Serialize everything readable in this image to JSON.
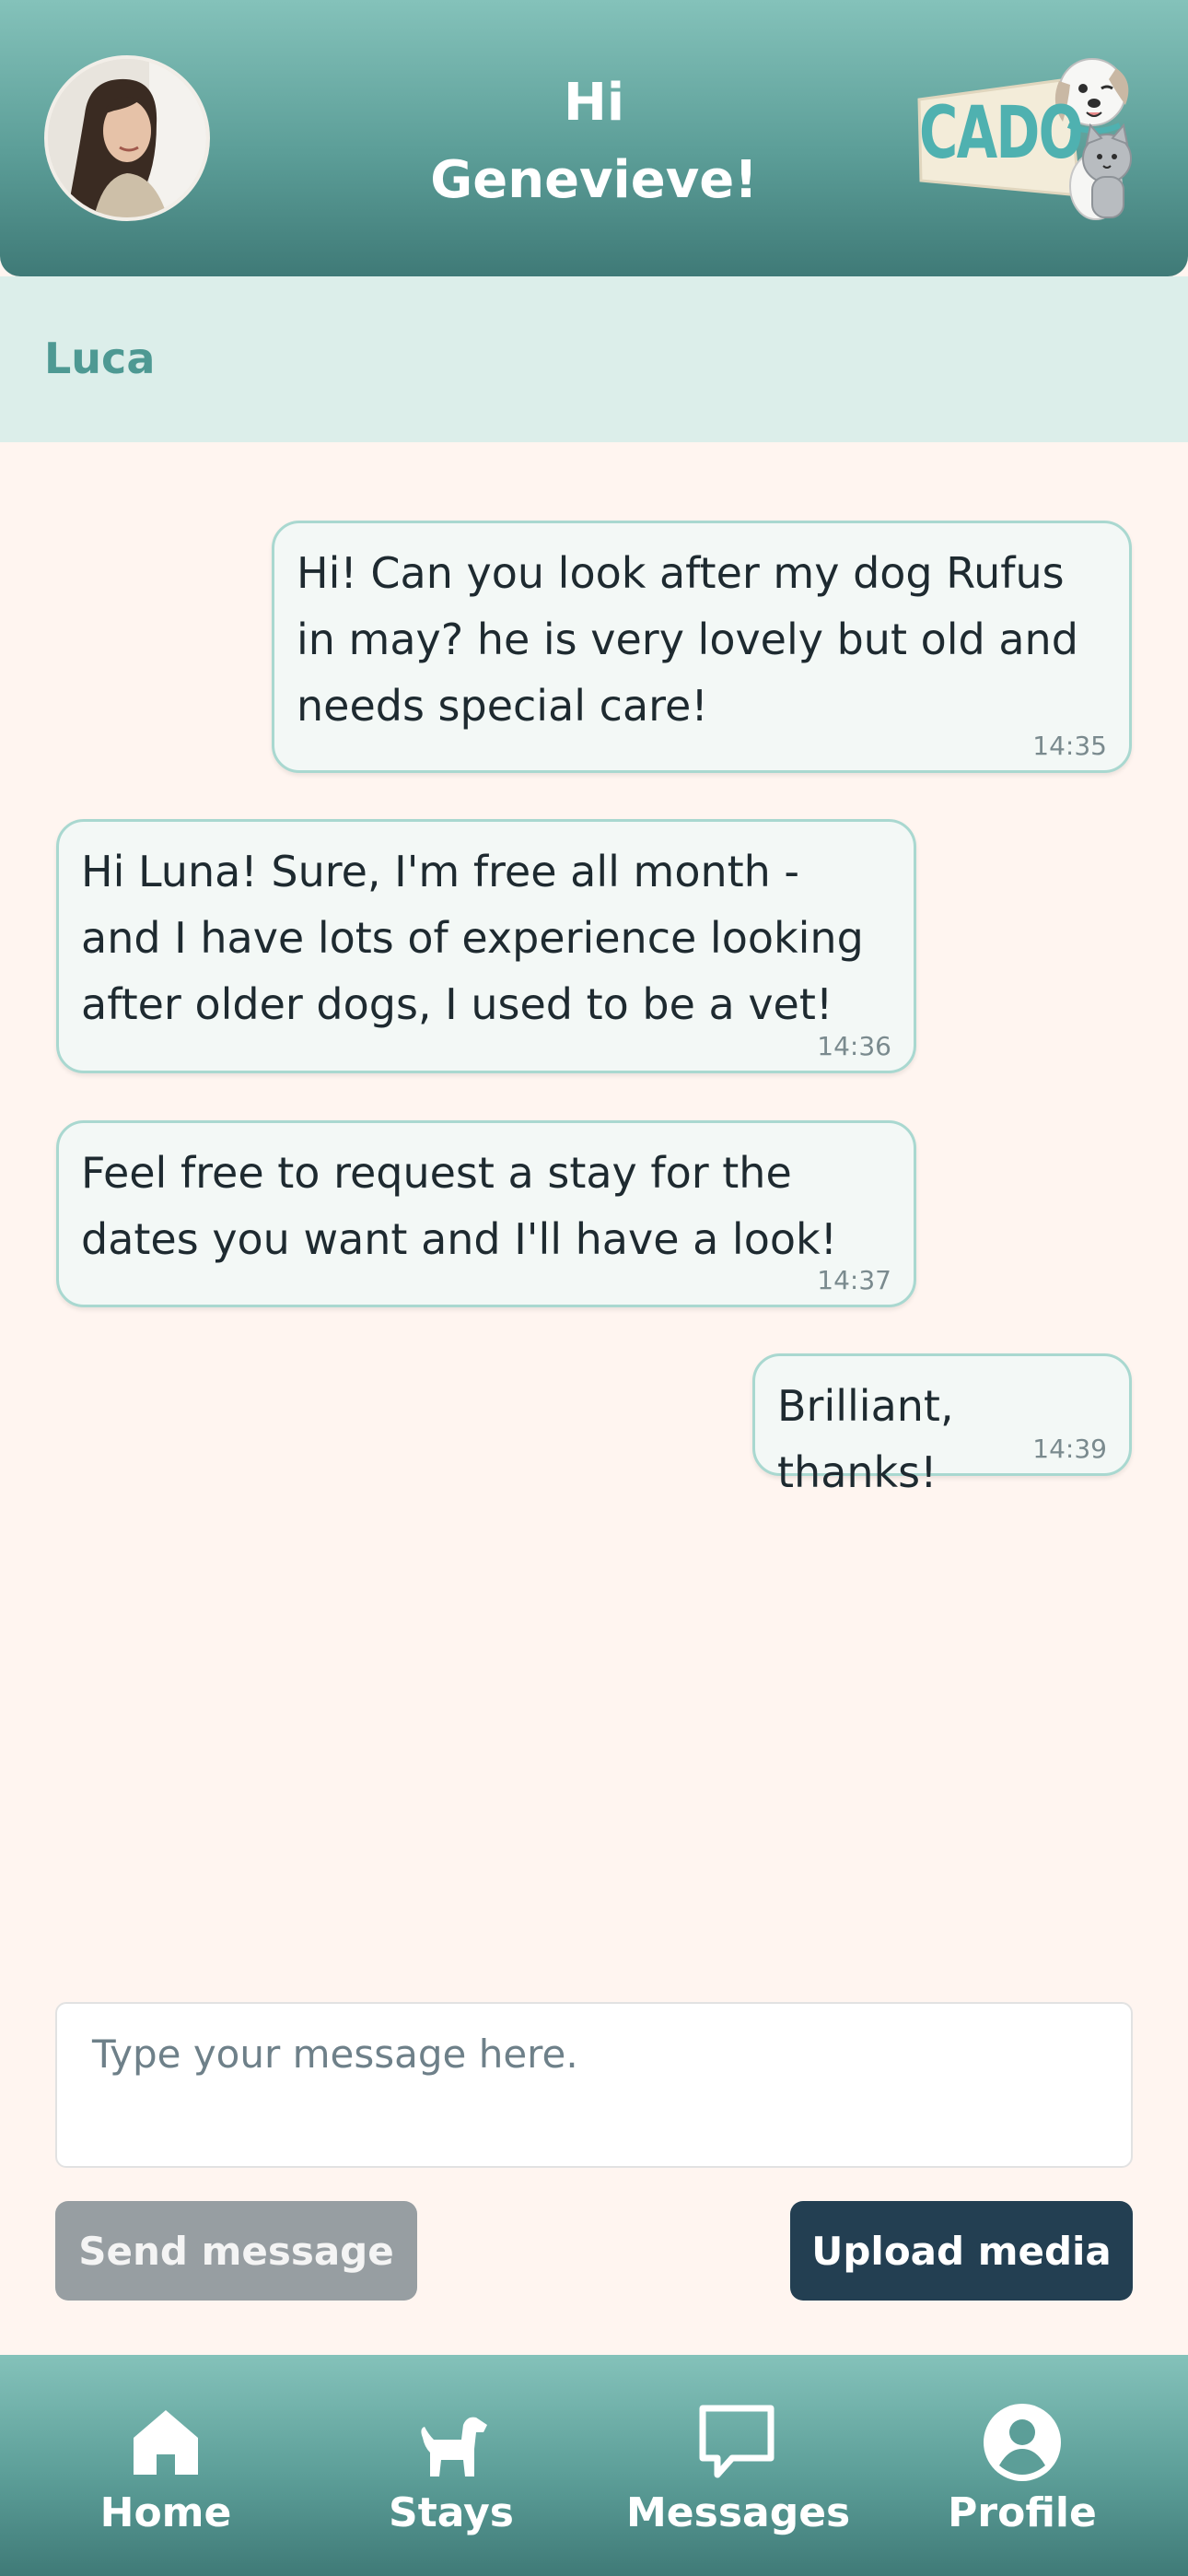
{
  "header": {
    "greeting_line1": "Hi",
    "greeting_line2": "Genevieve!",
    "logo_text": "CADO",
    "avatar_icon": "user-avatar-photo"
  },
  "contact": {
    "name": "Luca"
  },
  "messages": [
    {
      "side": "sent",
      "text": "Hi! Can you look after my dog Rufus in may? he is very lovely but old and needs special care!",
      "time": "14:35"
    },
    {
      "side": "received",
      "text": "Hi Luna! Sure, I'm free all month - and I have lots of experience looking after older dogs, I used to be a vet!",
      "time": "14:36"
    },
    {
      "side": "received",
      "text": "Feel free to request a stay for the dates you want and I'll have a look!",
      "time": "14:37"
    },
    {
      "side": "sent",
      "text": "Brilliant, thanks!",
      "time": "14:39"
    }
  ],
  "composer": {
    "placeholder": "Type your message here.",
    "value": "",
    "send_label": "Send message",
    "upload_label": "Upload media"
  },
  "nav": {
    "items": [
      {
        "label": "Home",
        "icon": "home-icon"
      },
      {
        "label": "Stays",
        "icon": "dog-icon"
      },
      {
        "label": "Messages",
        "icon": "chat-bubble-icon"
      },
      {
        "label": "Profile",
        "icon": "user-circle-icon"
      }
    ]
  },
  "colors": {
    "header_teal": "#5C9E98",
    "contact_bar": "#DCEEEA",
    "contact_name": "#4E9993",
    "chat_bg": "#FFF5F0",
    "bubble_bg": "#F3F8F6",
    "bubble_border": "#A9D8D0",
    "send_button": "#979EA2",
    "upload_button": "#233F52"
  }
}
